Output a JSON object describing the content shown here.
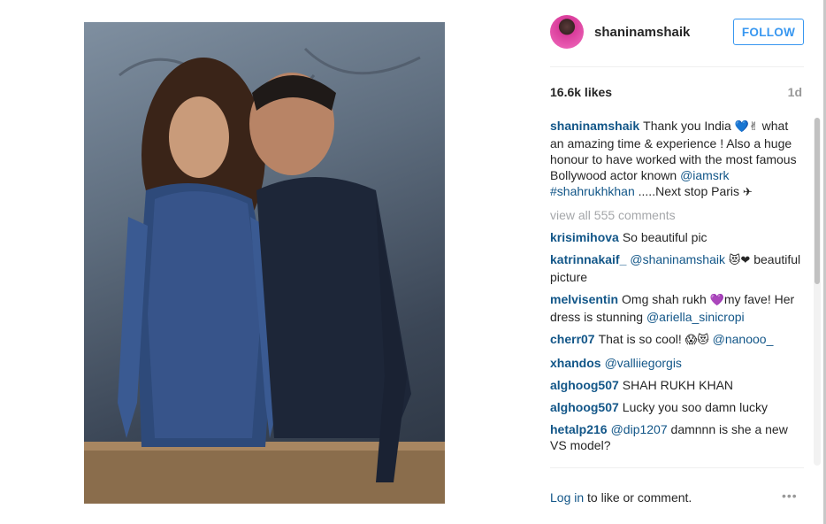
{
  "post": {
    "username": "shaninamshaik",
    "follow_label": "FOLLOW",
    "likes": "16.6k likes",
    "age": "1d",
    "caption": {
      "user": "shaninamshaik",
      "text_1": "Thank you India ",
      "emoji_1": "💙✌",
      "text_2": " what an amazing time & experience ! Also a huge honour to have worked with the most famous Bollywood actor known ",
      "mention_1": "@iamsrk",
      "hashtag_1": "#shahrukhkhan",
      "text_3": " .....Next stop Paris ",
      "emoji_2": "✈"
    },
    "view_all": "view all 555 comments",
    "comments": [
      {
        "user": "krisimihova",
        "text": "So beautiful pic"
      },
      {
        "user": "katrinnakaif_",
        "mention": "@shaninamshaik",
        "emoji": "😻❤",
        "text": "beautiful picture"
      },
      {
        "user": "melvisentin",
        "text": "Omg shah rukh ",
        "emoji": "💜",
        "text_2": "my fave! Her dress is stunning ",
        "mention": "@ariella_sinicropi"
      },
      {
        "user": "cherr07",
        "text": "That is so cool! ",
        "emoji": "😱😻",
        "mention": "@nanooo_"
      },
      {
        "user": "xhandos",
        "mention": "@valliiegorgis"
      },
      {
        "user": "alghoog507",
        "text": "SHAH RUKH KHAN"
      },
      {
        "user": "alghoog507",
        "text": "Lucky you soo damn lucky"
      },
      {
        "user": "hetalp216",
        "mention": "@dip1207",
        "text": " damnnn is she a new VS model?"
      }
    ],
    "footer": {
      "login_link": "Log in",
      "login_rest": " to like or comment.",
      "more_icon": "•••"
    }
  },
  "icons": {
    "more": "more-options-icon",
    "avatar": "profile-avatar"
  },
  "colors": {
    "username": "#125688",
    "accent": "#3897f0",
    "muted": "#999999"
  }
}
